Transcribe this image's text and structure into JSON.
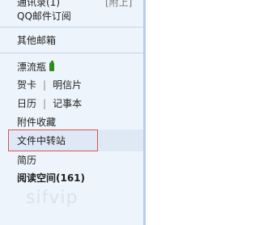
{
  "sidebar": {
    "top_partial": "通讯录(1)",
    "top_partial_badge": "[附上]",
    "qq_subscription": "QQ邮件订阅",
    "other_mailbox": "其他邮箱",
    "drift_bottle": "漂流瓶",
    "greeting_card": "贺卡",
    "postcard": "明信片",
    "calendar": "日历",
    "notebook": "记事本",
    "attachments": "附件收藏",
    "file_transfer": "文件中转站",
    "resume": "简历",
    "reading_space": "阅读空间(161)"
  },
  "separator": "|",
  "watermark": "sifvip",
  "colors": {
    "sidebar_bg": "#eef4fb",
    "highlight_bg": "#dfe9f6",
    "red_box": "#d9534f",
    "divider_line": "#c4d4e8"
  },
  "icons": [
    "bottle-icon"
  ]
}
